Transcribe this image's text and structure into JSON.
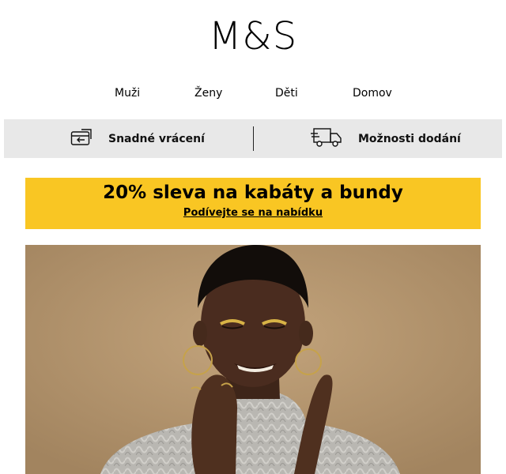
{
  "brand": {
    "logo_text": "M&S"
  },
  "nav": {
    "items": [
      {
        "label": "Muži"
      },
      {
        "label": "Ženy"
      },
      {
        "label": "Děti"
      },
      {
        "label": "Domov"
      }
    ]
  },
  "benefits": {
    "items": [
      {
        "icon": "return-card-icon",
        "label": "Snadné vrácení"
      },
      {
        "icon": "delivery-truck-icon",
        "label": "Možnosti dodání"
      }
    ]
  },
  "promo": {
    "title": "20% sleva na kabáty a bundy",
    "link_label": "Podívejte se na nabídku",
    "background_color": "#f9c623"
  },
  "hero": {
    "image_description": "hero-photo-woman-in-grey-knit-sweater"
  },
  "colors": {
    "benefits_bar": "#e8e8e8",
    "hero_background": "#b0916a",
    "text": "#000000"
  }
}
